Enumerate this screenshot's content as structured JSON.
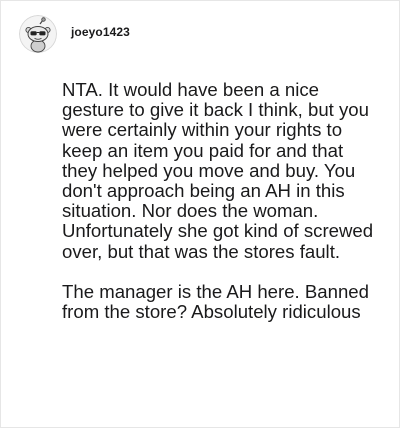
{
  "comment": {
    "author": "joeyo1423",
    "avatar_icon": "snoo-avatar-icon",
    "paragraphs": [
      "NTA. It would have been a nice gesture to give it back I think, but you were certainly within your rights to keep an item you paid for and that they helped you move and buy. You don't approach being an AH in this situation. Nor does the woman. Unfortunately she got kind of screwed over, but that was the stores fault.",
      "The manager is the AH here. Banned from the store? Absolutely ridiculous"
    ]
  }
}
